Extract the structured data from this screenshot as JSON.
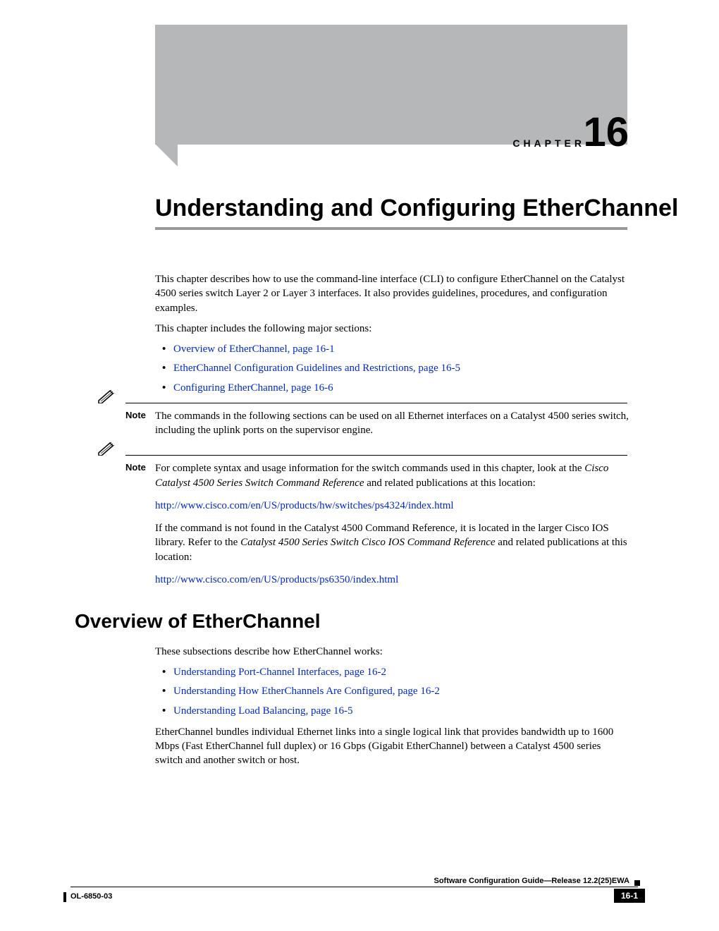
{
  "chapter": {
    "label": "CHAPTER",
    "number": "16",
    "title": "Understanding and Configuring EtherChannel"
  },
  "intro": {
    "p1": "This chapter describes how to use the command-line interface (CLI) to configure EtherChannel on the Catalyst 4500 series switch Layer 2 or Layer 3 interfaces. It also provides guidelines, procedures, and configuration examples.",
    "p2": "This chapter includes the following major sections:",
    "links": [
      "Overview of EtherChannel, page 16-1",
      "EtherChannel Configuration Guidelines and Restrictions, page 16-5",
      "Configuring EtherChannel, page 16-6"
    ]
  },
  "note1": {
    "label": "Note",
    "text": "The commands in the following sections can be used on all Ethernet interfaces on a Catalyst 4500 series switch, including the uplink ports on the supervisor engine."
  },
  "note2": {
    "label": "Note",
    "text_a": "For complete syntax and usage information for the switch commands used in this chapter, look at the ",
    "italic_a": "Cisco Catalyst 4500 Series Switch Command Reference",
    "text_b": " and related publications at this location:",
    "url1": "http://www.cisco.com/en/US/products/hw/switches/ps4324/index.html",
    "text_c": "If the command is not found in the Catalyst 4500 Command Reference, it is located in the larger Cisco IOS library. Refer to the ",
    "italic_b": "Catalyst 4500 Series Switch Cisco IOS Command Reference",
    "text_d": " and related publications at this location:",
    "url2": "http://www.cisco.com/en/US/products/ps6350/index.html"
  },
  "overview": {
    "heading": "Overview of EtherChannel",
    "intro": "These subsections describe how EtherChannel works:",
    "links": [
      "Understanding Port-Channel Interfaces, page 16-2",
      "Understanding How EtherChannels Are Configured, page 16-2",
      "Understanding Load Balancing, page 16-5"
    ],
    "body": "EtherChannel bundles individual Ethernet links into a single logical link that provides bandwidth up to 1600 Mbps (Fast EtherChannel full duplex) or 16 Gbps (Gigabit EtherChannel) between a Catalyst 4500 series switch and another switch or host."
  },
  "footer": {
    "guide_title": "Software Configuration Guide—Release 12.2(25)EWA",
    "doc_id": "OL-6850-03",
    "page": "16-1"
  }
}
